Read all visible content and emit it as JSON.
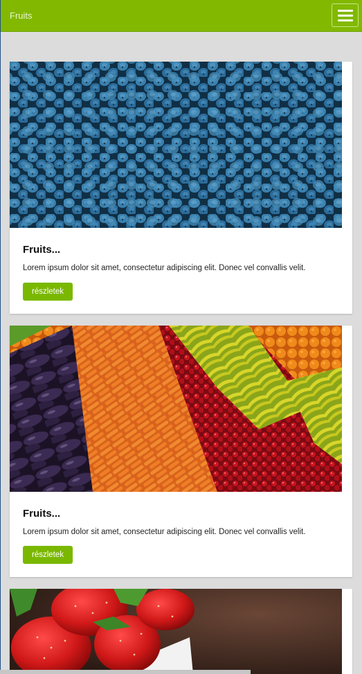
{
  "header": {
    "title": "Fruits",
    "menu_icon": "hamburger-menu-icon"
  },
  "cards": [
    {
      "image": "blueberries-photo",
      "title": "Fruits...",
      "text": "Lorem ipsum dolor sit amet, consectetur adipiscing elit. Donec vel convallis velit.",
      "button_label": "részletek"
    },
    {
      "image": "fruit-vegetable-market-photo",
      "title": "Fruits...",
      "text": "Lorem ipsum dolor sit amet, consectetur adipiscing elit. Donec vel convallis velit.",
      "button_label": "részletek"
    },
    {
      "image": "strawberries-photo"
    }
  ],
  "colors": {
    "accent": "#82b900",
    "background": "#dcdcdc",
    "button": "#7ab800"
  }
}
